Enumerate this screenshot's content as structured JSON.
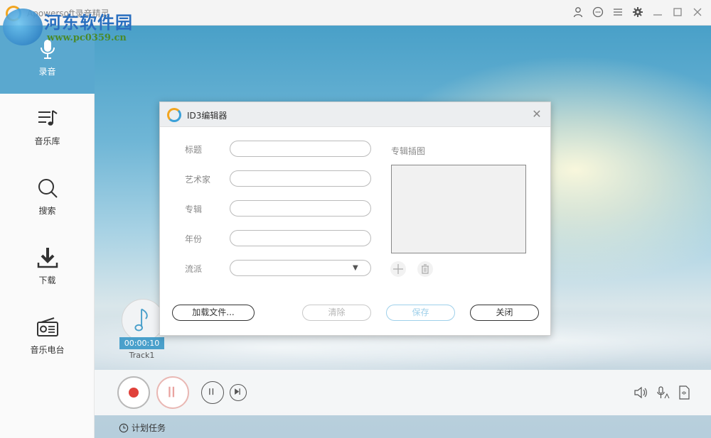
{
  "app": {
    "title": "Apowersoft录音精灵"
  },
  "watermark": {
    "title": "河东软件园",
    "url": "www.pc0359.cn"
  },
  "sidebar": {
    "items": [
      {
        "label": "录音",
        "icon": "microphone-icon",
        "active": true
      },
      {
        "label": "音乐库",
        "icon": "music-list-icon",
        "active": false
      },
      {
        "label": "搜索",
        "icon": "search-icon",
        "active": false
      },
      {
        "label": "下载",
        "icon": "download-icon",
        "active": false
      },
      {
        "label": "音乐电台",
        "icon": "radio-icon",
        "active": false
      }
    ]
  },
  "track": {
    "time": "00:00:10",
    "name": "Track1"
  },
  "statusbar": {
    "schedule_label": "计划任务"
  },
  "dialog": {
    "title": "ID3编辑器",
    "fields": {
      "title_label": "标题",
      "title_value": "",
      "artist_label": "艺术家",
      "artist_value": "",
      "album_label": "专辑",
      "album_value": "",
      "year_label": "年份",
      "year_value": "",
      "genre_label": "流派",
      "genre_value": ""
    },
    "cover_label": "专辑插图",
    "buttons": {
      "load": "加载文件...",
      "clear": "清除",
      "save": "保存",
      "close": "关闭"
    }
  },
  "colors": {
    "accent": "#5aa8cf",
    "record": "#e0413a",
    "brand_orange": "#f2a51f"
  }
}
